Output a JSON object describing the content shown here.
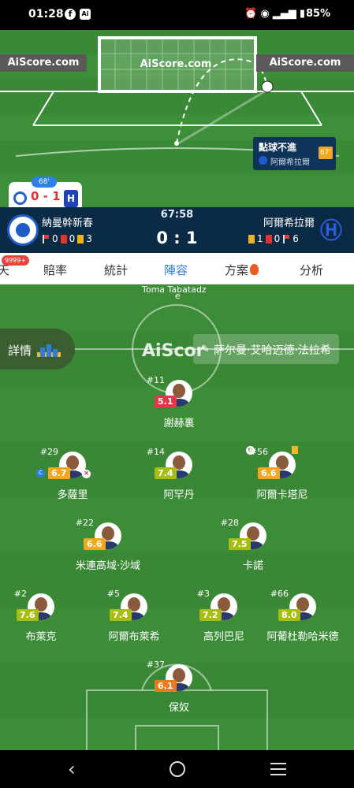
{
  "status_bar": {
    "time": "01:28",
    "battery": "85%",
    "app_icon_label": "Ai"
  },
  "animation": {
    "watermarks": [
      "AiScore.com",
      "AiScore.com",
      "AiScore.com"
    ],
    "event_title": "點球不進",
    "event_team": "阿爾希拉爾",
    "event_minute": "67'",
    "mini_minute": "68'",
    "mini_score": "0 - 1"
  },
  "match": {
    "home_team": "納曼幹新春",
    "away_team": "阿爾希拉爾",
    "clock": "67:58",
    "score": "0 : 1",
    "home_stats": {
      "corners": "0",
      "red": "0",
      "yellow": "3"
    },
    "away_stats": {
      "yellow": "1",
      "red": "0",
      "corners": "6"
    }
  },
  "tabs": {
    "badge": "9999+",
    "items": [
      "天",
      "賠率",
      "統計",
      "陣容",
      "方案",
      "分析"
    ],
    "active": "陣容"
  },
  "lineup": {
    "top_cut_name_1": "Toma Tabatadz",
    "top_cut_name_2": "e",
    "detail_label": "詳情",
    "watermark": "AiScor",
    "coach": "萨尔曼·艾哈迈德·法拉希",
    "players": [
      {
        "shirt": "#11",
        "rating": "5.1",
        "name": "謝赫裏"
      },
      {
        "shirt": "#29",
        "rating": "6.7",
        "name": "多薩里"
      },
      {
        "shirt": "#14",
        "rating": "7.4",
        "name": "阿罕丹"
      },
      {
        "shirt": "#56",
        "rating": "6.6",
        "name": "阿爾卡塔尼"
      },
      {
        "shirt": "#22",
        "rating": "6.6",
        "name": "米連高域·沙域"
      },
      {
        "shirt": "#28",
        "rating": "7.5",
        "name": "卡諾"
      },
      {
        "shirt": "#2",
        "rating": "7.6",
        "name": "布萊克"
      },
      {
        "shirt": "#5",
        "rating": "7.4",
        "name": "阿爾布萊希"
      },
      {
        "shirt": "#3",
        "rating": "7.2",
        "name": "高列巴尼"
      },
      {
        "shirt": "#66",
        "rating": "8.0",
        "name": "阿葡杜勒哈米德"
      },
      {
        "shirt": "#37",
        "rating": "6.1",
        "name": "保奴"
      }
    ]
  },
  "colors": {
    "pitch": "#3d8d38",
    "header_bg": "#0b2a45",
    "active_tab": "#2b7de9",
    "rating_red": "#e5374a",
    "rating_orange": "#f07a1a",
    "rating_amber": "#f3a720",
    "rating_olive": "#a7bd14"
  }
}
